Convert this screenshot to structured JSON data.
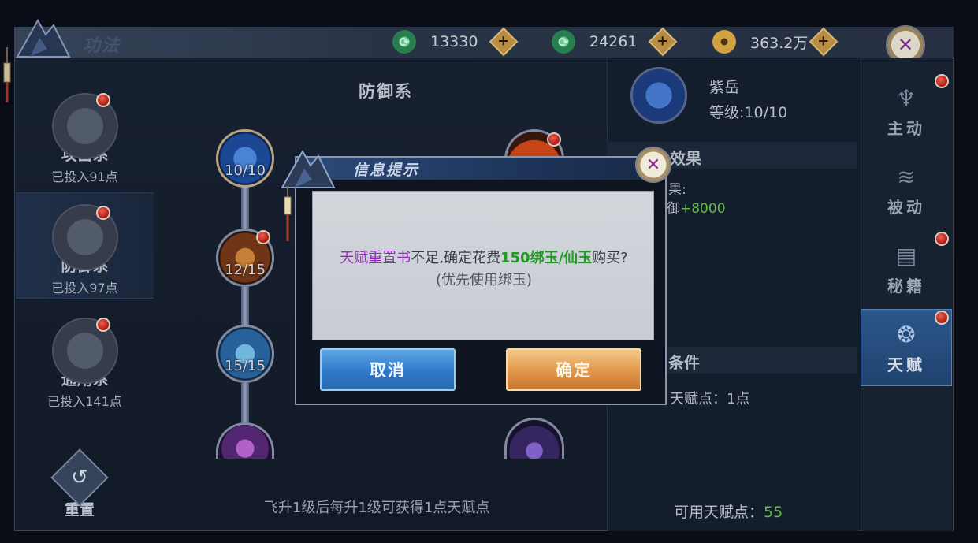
{
  "header": {
    "title": "功法",
    "currencies": [
      {
        "icon": "jade-green-icon",
        "value": "13330",
        "color": "#3aa86a"
      },
      {
        "icon": "jade-bound-icon",
        "value": "24261",
        "color": "#3aa86a"
      },
      {
        "icon": "coin-icon",
        "value": "363.2万",
        "color": "#d4a23a"
      }
    ]
  },
  "categories": [
    {
      "name": "攻击系",
      "points": "已投入91点",
      "badge": true,
      "active": false
    },
    {
      "name": "防御系",
      "points": "已投入97点",
      "badge": true,
      "active": true
    },
    {
      "name": "通用系",
      "points": "已投入141点",
      "badge": true,
      "active": false
    }
  ],
  "reset": {
    "label": "重置"
  },
  "tree": {
    "title": "防御系",
    "nodes": [
      {
        "level": "10/10",
        "icon": "shield-skill-icon"
      },
      {
        "level": "12/15",
        "icon": "beast-skill-icon"
      },
      {
        "level": "15/15",
        "icon": "frost-skill-icon"
      },
      {
        "level": "",
        "icon": "shadow-skill-icon"
      }
    ],
    "hint": "飞升1级后每升1级可获得1点天赋点"
  },
  "detail": {
    "name": "紫岳",
    "level": "等级:10/10",
    "effect_title_visible": "效果",
    "effect_label_partial": "果:",
    "effect_value_prefix": "御",
    "effect_value": "+8000",
    "condition_title_partial": "条件",
    "condition_text_partial": "天赋点：1点",
    "available_label": "可用天赋点：",
    "available_value": "55"
  },
  "tabs": [
    {
      "label": "主动",
      "icon": "active-skill-icon",
      "badge": true,
      "active": false
    },
    {
      "label": "被动",
      "icon": "passive-skill-icon",
      "badge": false,
      "active": false
    },
    {
      "label": "秘籍",
      "icon": "book-icon",
      "badge": true,
      "active": false
    },
    {
      "label": "天赋",
      "icon": "talent-icon",
      "badge": true,
      "active": true
    }
  ],
  "dialog": {
    "title": "信息提示",
    "item_name": "天赋重置书",
    "text_mid": "不足,确定花费",
    "price": "150绑玉/仙玉",
    "text_end": "购买?",
    "note": "(优先使用绑玉)",
    "cancel_label": "取消",
    "confirm_label": "确定"
  }
}
